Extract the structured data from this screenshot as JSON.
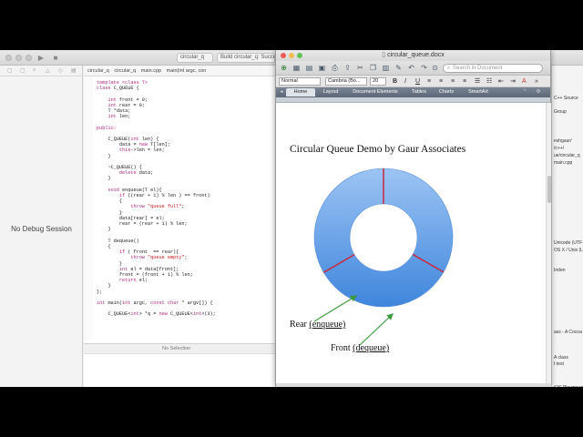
{
  "xcode": {
    "tabs": {
      "target": "circular_q",
      "status": "Build circular_q: Succee"
    },
    "jumpbar": [
      "circular_q",
      "circular_q",
      "main.cpp",
      "main(int argc, con"
    ],
    "debug_area": {
      "message": "No Debug Session"
    },
    "debug_bar": {
      "selection": "No Selection"
    },
    "code_lines": [
      [
        [
          "template ",
          "kw"
        ],
        [
          "<class T>",
          "kw"
        ]
      ],
      [
        [
          "class ",
          "kw"
        ],
        [
          "C_QUEUE {",
          ""
        ]
      ],
      [
        [
          "",
          ""
        ]
      ],
      [
        [
          "    int ",
          "kw"
        ],
        [
          "front = 0;",
          ""
        ]
      ],
      [
        [
          "    int ",
          "kw"
        ],
        [
          "rear = 0;",
          ""
        ]
      ],
      [
        [
          "    T *data;",
          ""
        ]
      ],
      [
        [
          "    int ",
          "kw"
        ],
        [
          "len;",
          ""
        ]
      ],
      [
        [
          "",
          ""
        ]
      ],
      [
        [
          "public:",
          "kw"
        ]
      ],
      [
        [
          "",
          ""
        ]
      ],
      [
        [
          "    C_QUEUE(",
          ""
        ],
        [
          "int ",
          "kw"
        ],
        [
          "len) {",
          ""
        ]
      ],
      [
        [
          "        data = ",
          ""
        ],
        [
          "new ",
          "kw"
        ],
        [
          "T[len];",
          ""
        ]
      ],
      [
        [
          "        this",
          "kw"
        ],
        [
          "->len = len;",
          ""
        ]
      ],
      [
        [
          "    }",
          ""
        ]
      ],
      [
        [
          "",
          ""
        ]
      ],
      [
        [
          "    ~C_QUEUE() {",
          ""
        ]
      ],
      [
        [
          "        delete ",
          "kw"
        ],
        [
          "data;",
          ""
        ]
      ],
      [
        [
          "    }",
          ""
        ]
      ],
      [
        [
          "",
          ""
        ]
      ],
      [
        [
          "    void ",
          "kw"
        ],
        [
          "enqueue(T el){",
          ""
        ]
      ],
      [
        [
          "        if ",
          "kw"
        ],
        [
          "((rear + 1) % len ) == front)",
          ""
        ]
      ],
      [
        [
          "        {",
          ""
        ]
      ],
      [
        [
          "            throw ",
          "kw"
        ],
        [
          "\"queue full\"",
          "st"
        ],
        [
          ";",
          ""
        ]
      ],
      [
        [
          "        }",
          ""
        ]
      ],
      [
        [
          "        data[rear] = el;",
          ""
        ]
      ],
      [
        [
          "        rear = (rear + 1) % len;",
          ""
        ]
      ],
      [
        [
          "    }",
          ""
        ]
      ],
      [
        [
          "",
          ""
        ]
      ],
      [
        [
          "    T dequeue()",
          ""
        ]
      ],
      [
        [
          "    {",
          ""
        ]
      ],
      [
        [
          "        if ",
          "kw"
        ],
        [
          "( front  == rear){",
          ""
        ]
      ],
      [
        [
          "            throw ",
          "kw"
        ],
        [
          "\"queue empty\"",
          "st"
        ],
        [
          ";",
          ""
        ]
      ],
      [
        [
          "        }",
          ""
        ]
      ],
      [
        [
          "        int ",
          "kw"
        ],
        [
          "el = data[front];",
          ""
        ]
      ],
      [
        [
          "        front = (front + 1) % len;",
          ""
        ]
      ],
      [
        [
          "        return ",
          "kw"
        ],
        [
          "el;",
          ""
        ]
      ],
      [
        [
          "    }",
          ""
        ]
      ],
      [
        [
          "};",
          ""
        ]
      ],
      [
        [
          "",
          ""
        ]
      ],
      [
        [
          "int ",
          "kw"
        ],
        [
          "main(",
          ""
        ],
        [
          "int ",
          "kw"
        ],
        [
          "argc, ",
          ""
        ],
        [
          "const char ",
          "kw"
        ],
        [
          "* argv[]) {",
          ""
        ]
      ],
      [
        [
          "",
          ""
        ]
      ],
      [
        [
          "    C_QUEUE<",
          ""
        ],
        [
          "int",
          "kw"
        ],
        [
          "> *q = ",
          ""
        ],
        [
          "new ",
          "kw"
        ],
        [
          "C_QUEUE<",
          ""
        ],
        [
          "int",
          "kw"
        ],
        [
          ">(3);",
          ""
        ]
      ]
    ],
    "inspector": [
      "C++ Source",
      "Group",
      "eshgaur/",
      "/c++/",
      "ue/circular_q",
      "main.cpp",
      "Unicode (UTF-",
      "OS X / Unix (LF)",
      "Inden",
      "ass - A Cocoa",
      "A class",
      "t test",
      "iOS Playgroun"
    ]
  },
  "word": {
    "window_title": "circular_queue.docx",
    "search_placeholder": "Search in Document",
    "style_select": "Normal",
    "font_select": "Cambria (Bo...",
    "size_select": "20",
    "ribbon_tabs": [
      "Home",
      "Layout",
      "Document Elements",
      "Tables",
      "Charts",
      "SmartArt"
    ],
    "doc": {
      "title": "Circular Queue Demo by Gaur Associates",
      "rear_label": "Rear",
      "rear_op": "(enqueue)",
      "front_label": "Front",
      "front_op": "(dequeue)"
    }
  },
  "chart_data": {
    "type": "pie",
    "title": "",
    "categories": [
      "",
      "",
      ""
    ],
    "values": [
      33.3,
      33.3,
      33.4
    ],
    "donut": true,
    "colors": {
      "fill": "#6da7ea",
      "separator": "#c8283c",
      "arrow": "#3c9a3c"
    }
  }
}
